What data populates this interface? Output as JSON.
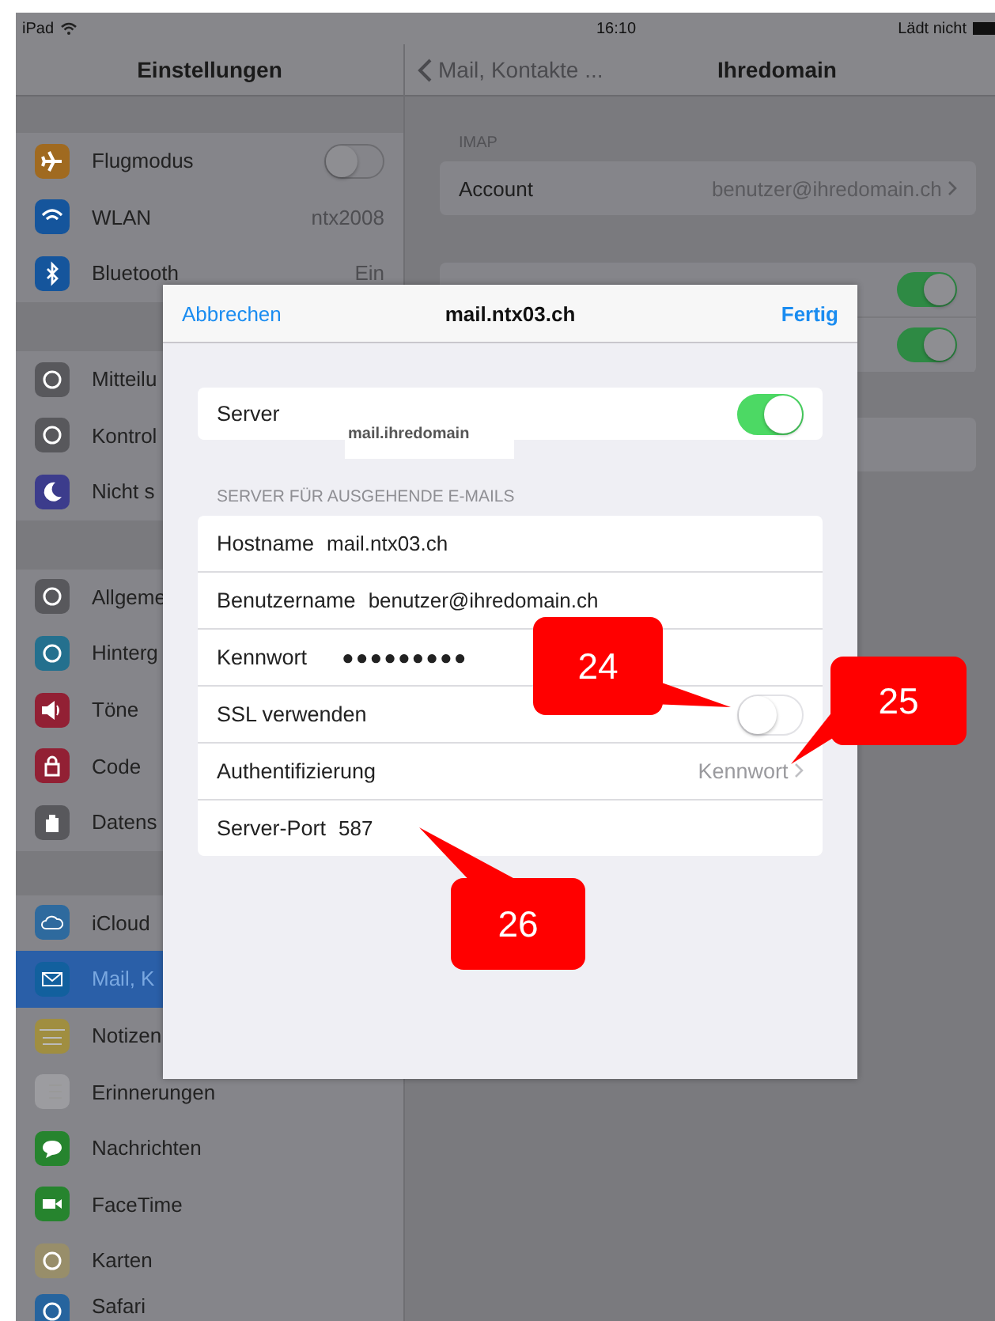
{
  "status_bar": {
    "device": "iPad",
    "time": "16:10",
    "battery": "Lädt nicht"
  },
  "sidebar": {
    "title": "Einstellungen",
    "groups": [
      [
        {
          "label": "Flugmodus",
          "kind": "toggle",
          "on": false,
          "selected": false
        },
        {
          "label": "WLAN",
          "kind": "value",
          "value": "ntx2008",
          "selected": false
        },
        {
          "label": "Bluetooth",
          "kind": "value",
          "value": "Ein",
          "selected": false
        }
      ],
      [
        {
          "label": "Mitteilu",
          "kind": "plain",
          "selected": false
        },
        {
          "label": "Kontrol",
          "kind": "plain",
          "selected": false
        },
        {
          "label": "Nicht s",
          "kind": "plain",
          "selected": false
        }
      ],
      [
        {
          "label": "Allgeme",
          "kind": "plain",
          "selected": false
        },
        {
          "label": "Hinterg",
          "kind": "plain",
          "selected": false
        },
        {
          "label": "Töne",
          "kind": "plain",
          "selected": false
        },
        {
          "label": "Code",
          "kind": "plain",
          "selected": false
        },
        {
          "label": "Datens",
          "kind": "plain",
          "selected": false
        }
      ],
      [
        {
          "label": "iCloud",
          "kind": "plain",
          "selected": false
        },
        {
          "label": "Mail, K",
          "kind": "plain",
          "selected": true
        },
        {
          "label": "Notizen",
          "kind": "plain",
          "selected": false
        },
        {
          "label": "Erinnerungen",
          "kind": "plain",
          "selected": false
        },
        {
          "label": "Nachrichten",
          "kind": "plain",
          "selected": false
        },
        {
          "label": "FaceTime",
          "kind": "plain",
          "selected": false
        },
        {
          "label": "Karten",
          "kind": "plain",
          "selected": false
        },
        {
          "label": "Safari",
          "kind": "plain",
          "selected": false
        }
      ]
    ]
  },
  "detail": {
    "back": "Mail, Kontakte ...",
    "title": "Ihredomain",
    "section": "IMAP",
    "account": {
      "label": "Account",
      "value": "benutzer@ihredomain.ch"
    },
    "toggles": [
      {
        "on": true
      },
      {
        "on": true
      }
    ]
  },
  "dialog": {
    "cancel": "Abbrechen",
    "title": "mail.ntx03.ch",
    "done": "Fertig",
    "server": {
      "label": "Server",
      "on": true
    },
    "sticker": "mail.ihredomain",
    "section": "SERVER FÜR AUSGEHENDE E-MAILS",
    "rows": [
      {
        "kind": "field",
        "label": "Hostname",
        "value": "mail.ntx03.ch"
      },
      {
        "kind": "field",
        "label": "Benutzername",
        "value": "benutzer@ihredomain.ch"
      },
      {
        "kind": "password",
        "label": "Kennwort",
        "value": "●●●●●●●●●"
      },
      {
        "kind": "toggle",
        "label": "SSL verwenden",
        "on": false
      },
      {
        "kind": "link",
        "label": "Authentifizierung",
        "value": "Kennwort"
      },
      {
        "kind": "field",
        "label": "Server-Port",
        "value": "587"
      }
    ]
  },
  "callouts": [
    {
      "label": "24"
    },
    {
      "label": "25"
    },
    {
      "label": "26"
    }
  ]
}
